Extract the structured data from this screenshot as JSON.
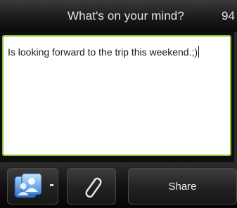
{
  "header": {
    "title": "What's on your mind?",
    "char_count": "94"
  },
  "composer": {
    "text": "Is looking forward to the trip this weekend.;)"
  },
  "toolbar": {
    "people_icon": "people-icon",
    "attach_icon": "paperclip-icon",
    "share_label": "Share"
  }
}
